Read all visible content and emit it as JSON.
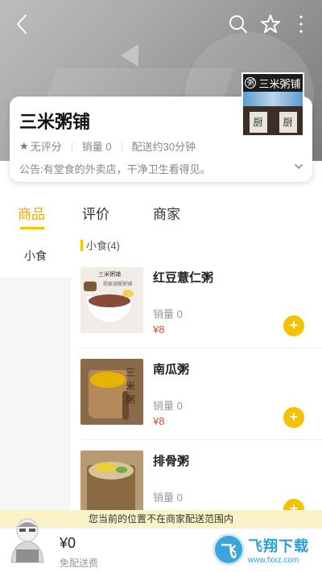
{
  "shop": {
    "name": "三米粥铺",
    "rating": "无评分",
    "sales": "销量 0",
    "delivery_time": "配送约30分钟",
    "notice": "公告:有堂食的外卖店，干净卫生看得见。",
    "logo": {
      "title": "三米粥铺",
      "seal": "粥",
      "box_left": "厨",
      "box_right": "厨"
    }
  },
  "tabs": [
    {
      "label": "商品",
      "active": true
    },
    {
      "label": "评价",
      "active": false
    },
    {
      "label": "商家",
      "active": false
    }
  ],
  "categories": [
    {
      "label": "小食",
      "selected": true
    }
  ],
  "section": {
    "title": "小食(4)"
  },
  "products": [
    {
      "name": "红豆薏仁粥",
      "sales": "销量 0",
      "price": "¥8",
      "image_text": {
        "title": "三米粥铺",
        "sub": "杨家湖餐粥铺"
      }
    },
    {
      "name": "南瓜粥",
      "sales": "销量 0",
      "price": "¥8",
      "image_text": {
        "logo": "三米粥"
      }
    },
    {
      "name": "排骨粥",
      "sales": "销量 0",
      "price": "",
      "image_text": {}
    }
  ],
  "warning": "您当前的位置不在商家配送范围内",
  "cart": {
    "price": "¥0",
    "delivery": "免配送费"
  },
  "watermark": {
    "title": "飞翔下载",
    "url": "www.fxxz.com",
    "logo_char": "飞"
  },
  "colors": {
    "accent": "#f5c200",
    "active_tab": "#f5a800",
    "price": "#e8472b",
    "warning_bg": "#fbf3c8"
  },
  "icons": [
    "back-icon",
    "search-icon",
    "star-icon",
    "more-icon",
    "chevron-down-icon",
    "add-icon"
  ]
}
